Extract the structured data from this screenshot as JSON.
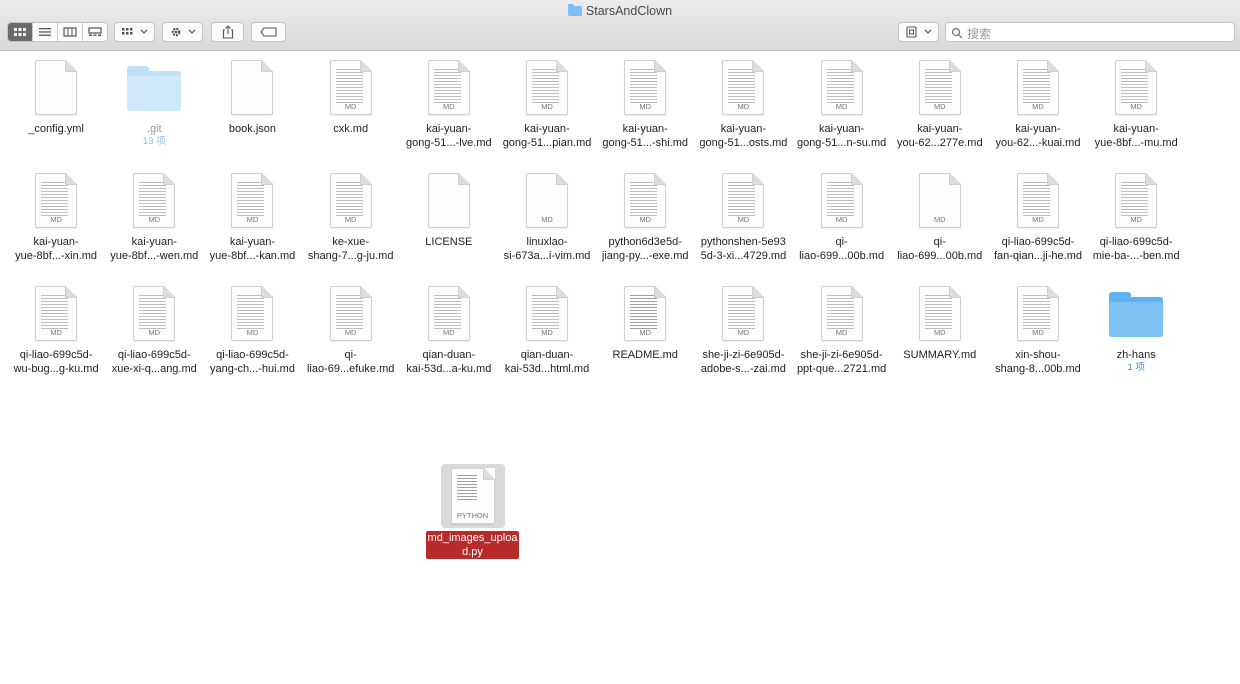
{
  "window": {
    "title": "StarsAndClown"
  },
  "toolbar": {
    "view_buttons": [
      "icon-view",
      "list-view",
      "column-view",
      "gallery-view"
    ],
    "group_button": "group-menu",
    "action_button": "gear-menu",
    "share_button": "share",
    "tags_button": "tags",
    "quicklook_button": "quick-look",
    "search_placeholder": "搜索"
  },
  "files": [
    {
      "name": "_config.yml",
      "kind": "doc",
      "tag": ""
    },
    {
      "name": ".git",
      "kind": "folder-ghost",
      "sub": "13 项"
    },
    {
      "name": "book.json",
      "kind": "doc",
      "tag": ""
    },
    {
      "name": "cxk.md",
      "kind": "doc-lines",
      "tag": "MD"
    },
    {
      "name": "kai-yuan-gong-51...-lve.md",
      "kind": "doc-lines",
      "tag": "MD"
    },
    {
      "name": "kai-yuan-gong-51...pian.md",
      "kind": "doc-lines",
      "tag": "MD"
    },
    {
      "name": "kai-yuan-gong-51...-shi.md",
      "kind": "doc-lines",
      "tag": "MD"
    },
    {
      "name": "kai-yuan-gong-51...osts.md",
      "kind": "doc-lines",
      "tag": "MD"
    },
    {
      "name": "kai-yuan-gong-51...n-su.md",
      "kind": "doc-lines",
      "tag": "MD"
    },
    {
      "name": "kai-yuan-you-62...277e.md",
      "kind": "doc-lines",
      "tag": "MD"
    },
    {
      "name": "kai-yuan-you-62...-kuai.md",
      "kind": "doc-lines",
      "tag": "MD"
    },
    {
      "name": "kai-yuan-yue-8bf...-mu.md",
      "kind": "doc-lines",
      "tag": "MD"
    },
    {
      "name": "kai-yuan-yue-8bf...-xin.md",
      "kind": "doc-lines",
      "tag": "MD"
    },
    {
      "name": "kai-yuan-yue-8bf...-wen.md",
      "kind": "doc-lines",
      "tag": "MD"
    },
    {
      "name": "kai-yuan-yue-8bf...-kan.md",
      "kind": "doc-lines",
      "tag": "MD"
    },
    {
      "name": "ke-xue-shang-7...g-ju.md",
      "kind": "doc-lines",
      "tag": "MD"
    },
    {
      "name": "LICENSE",
      "kind": "doc",
      "tag": ""
    },
    {
      "name": "linuxlao-si-673a...i-vim.md",
      "kind": "doc",
      "tag": "MD"
    },
    {
      "name": "python6d3e5d-jiang-py...-exe.md",
      "kind": "doc-lines",
      "tag": "MD"
    },
    {
      "name": "pythonshen-5e935d-3-xi...4729.md",
      "kind": "doc-lines",
      "tag": "MD"
    },
    {
      "name": "qi-liao-699...00b.md",
      "kind": "doc-lines",
      "tag": "MD"
    },
    {
      "name": "qi-liao-699...00b.md",
      "kind": "doc",
      "tag": "MD"
    },
    {
      "name": "qi-liao-699c5d-fan-qian...ji-he.md",
      "kind": "doc-lines",
      "tag": "MD"
    },
    {
      "name": "qi-liao-699c5d-mie-ba-...-ben.md",
      "kind": "doc-lines",
      "tag": "MD"
    },
    {
      "name": "qi-liao-699c5d-wu-bug...g-ku.md",
      "kind": "doc-lines",
      "tag": "MD"
    },
    {
      "name": "qi-liao-699c5d-xue-xi-q...ang.md",
      "kind": "doc-lines",
      "tag": "MD"
    },
    {
      "name": "qi-liao-699c5d-yang-ch...-hui.md",
      "kind": "doc-lines",
      "tag": "MD"
    },
    {
      "name": "qi-liao-69...efuke.md",
      "kind": "doc-lines",
      "tag": "MD"
    },
    {
      "name": "qian-duan-kai-53d...a-ku.md",
      "kind": "doc-lines",
      "tag": "MD"
    },
    {
      "name": "qian-duan-kai-53d...html.md",
      "kind": "doc-lines",
      "tag": "MD"
    },
    {
      "name": "README.md",
      "kind": "doc-dense",
      "tag": "MD"
    },
    {
      "name": "she-ji-zi-6e905d-adobe-s...-zai.md",
      "kind": "doc-lines",
      "tag": "MD"
    },
    {
      "name": "she-ji-zi-6e905d-ppt-que...2721.md",
      "kind": "doc-lines",
      "tag": "MD"
    },
    {
      "name": "SUMMARY.md",
      "kind": "doc-lines",
      "tag": "MD"
    },
    {
      "name": "xin-shou-shang-8...00b.md",
      "kind": "doc-lines",
      "tag": "MD"
    },
    {
      "name": "zh-hans",
      "kind": "folder",
      "sub": "1 项"
    }
  ],
  "labels": {
    "row1": [
      [
        "_config.yml"
      ],
      [
        ".git"
      ],
      [
        "book.json"
      ],
      [
        "cxk.md"
      ],
      [
        "kai-yuan-",
        "gong-51...-lve.md"
      ],
      [
        "kai-yuan-",
        "gong-51...pian.md"
      ],
      [
        "kai-yuan-",
        "gong-51...-shi.md"
      ],
      [
        "kai-yuan-",
        "gong-51...osts.md"
      ],
      [
        "kai-yuan-",
        "gong-51...n-su.md"
      ],
      [
        "kai-yuan-",
        "you-62...277e.md"
      ],
      [
        "kai-yuan-",
        "you-62...-kuai.md"
      ],
      [
        "kai-yuan-",
        "yue-8bf...-mu.md"
      ]
    ],
    "row2": [
      [
        "kai-yuan-",
        "yue-8bf...-xin.md"
      ],
      [
        "kai-yuan-",
        "yue-8bf...-wen.md"
      ],
      [
        "kai-yuan-",
        "yue-8bf...-kan.md"
      ],
      [
        "ke-xue-",
        "shang-7...g-ju.md"
      ],
      [
        "LICENSE"
      ],
      [
        "linuxlao-",
        "si-673a...i-vim.md"
      ],
      [
        "python6d3e5d-",
        "jiang-py...-exe.md"
      ],
      [
        "pythonshen-5e93",
        "5d-3-xi...4729.md"
      ],
      [
        "qi-",
        "liao-699...00b.md"
      ],
      [
        "qi-",
        "liao-699...00b.md"
      ],
      [
        "qi-liao-699c5d-",
        "fan-qian...ji-he.md"
      ],
      [
        "qi-liao-699c5d-",
        "mie-ba-...-ben.md"
      ]
    ],
    "row3": [
      [
        "qi-liao-699c5d-",
        "wu-bug...g-ku.md"
      ],
      [
        "qi-liao-699c5d-",
        "xue-xi-q...ang.md"
      ],
      [
        "qi-liao-699c5d-",
        "yang-ch...-hui.md"
      ],
      [
        "qi-",
        "liao-69...efuke.md"
      ],
      [
        "qian-duan-",
        "kai-53d...a-ku.md"
      ],
      [
        "qian-duan-",
        "kai-53d...html.md"
      ],
      [
        "README.md"
      ],
      [
        "she-ji-zi-6e905d-",
        "adobe-s...-zai.md"
      ],
      [
        "she-ji-zi-6e905d-",
        "ppt-que...2721.md"
      ],
      [
        "SUMMARY.md"
      ],
      [
        "xin-shou-",
        "shang-8...00b.md"
      ],
      [
        "zh-hans"
      ]
    ]
  },
  "selected_file": {
    "line1": "md_images_uploa",
    "line2": "d.py",
    "tag": "PYTHON"
  }
}
